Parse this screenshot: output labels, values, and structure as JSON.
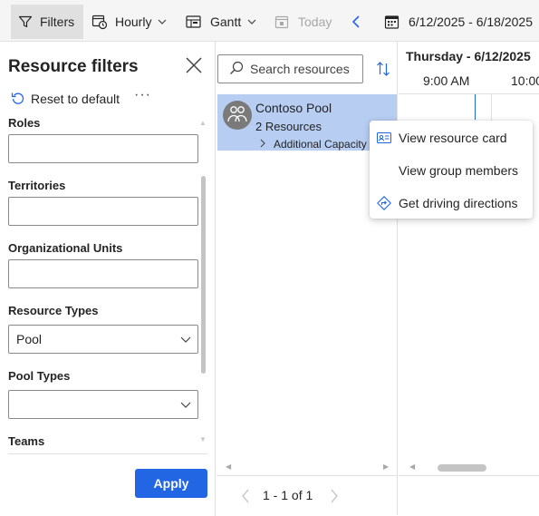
{
  "toolbar": {
    "filters_label": "Filters",
    "hourly_label": "Hourly",
    "gantt_label": "Gantt",
    "today_label": "Today",
    "date_range": "6/12/2025 - 6/18/2025"
  },
  "filter_pane": {
    "title": "Resource filters",
    "reset_label": "Reset to default",
    "more_label": "···",
    "fields": {
      "roles": {
        "label": "Roles",
        "value": ""
      },
      "territories": {
        "label": "Territories",
        "value": ""
      },
      "org_units": {
        "label": "Organizational Units",
        "value": ""
      },
      "resource_types": {
        "label": "Resource Types",
        "value": "Pool"
      },
      "pool_types": {
        "label": "Pool Types",
        "value": ""
      },
      "teams": {
        "label": "Teams"
      }
    },
    "apply_label": "Apply"
  },
  "resource_list": {
    "search_placeholder": "Search resources",
    "resource": {
      "name": "Contoso Pool",
      "count": "2 Resources",
      "extra": "Additional Capacity"
    }
  },
  "pagination": {
    "text": "1 - 1 of 1"
  },
  "gantt": {
    "day_label": "Thursday - 6/12/2025",
    "time_1": "9:00 AM",
    "time_2": "10:00"
  },
  "context_menu": {
    "items": [
      {
        "label": "View resource card",
        "icon": "contact-card-icon"
      },
      {
        "label": "View group members",
        "icon": ""
      },
      {
        "label": "Get driving directions",
        "icon": "directions-icon"
      }
    ]
  },
  "colors": {
    "accent": "#2266e3",
    "selected_row": "#b7cdf2",
    "toolbar_bg": "#f5f5f5"
  }
}
